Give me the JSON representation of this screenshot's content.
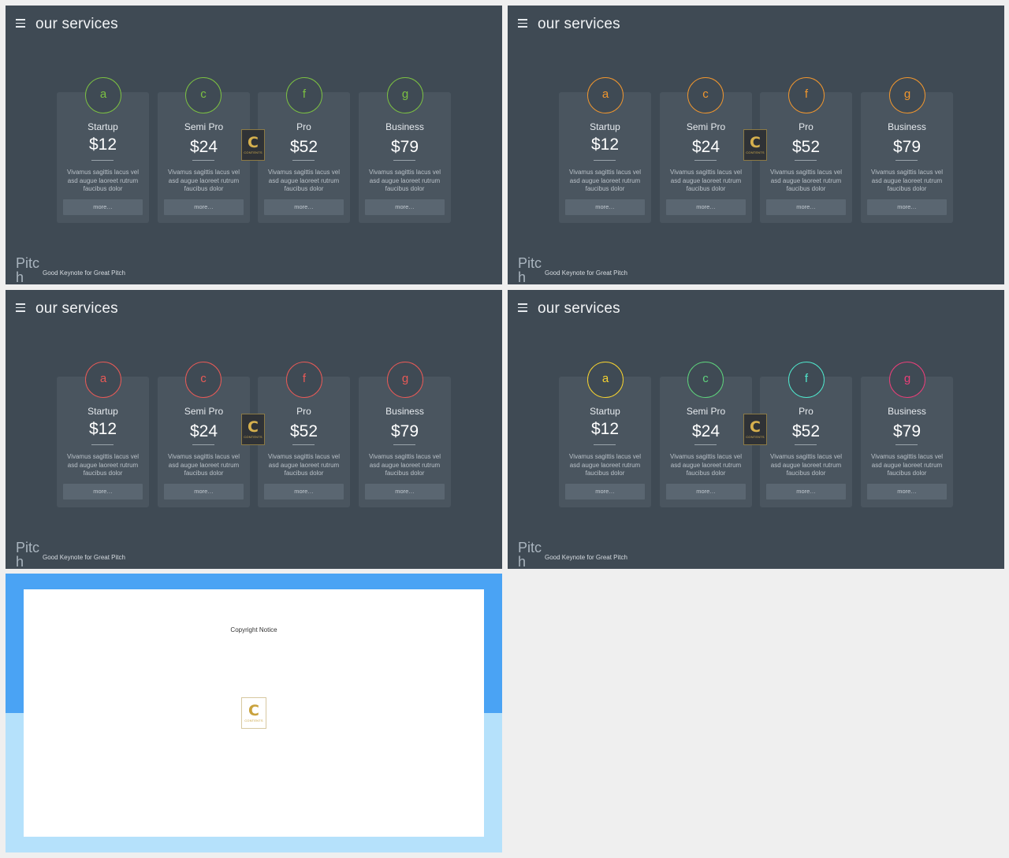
{
  "slide_title": "our services",
  "brand": "Pitch",
  "tagline": "Good Keynote for Great Pitch",
  "cards": [
    {
      "plan": "Startup",
      "price": "$12",
      "desc": "Vivamus sagittis lacus vel asd augue laoreet rutrum faucibus dolor",
      "more": "more…"
    },
    {
      "plan": "Semi Pro",
      "price": "$24",
      "desc": "Vivamus sagittis lacus vel asd augue laoreet rutrum faucibus dolor",
      "more": "more…"
    },
    {
      "plan": "Pro",
      "price": "$52",
      "desc": "Vivamus sagittis lacus vel asd augue laoreet rutrum faucibus dolor",
      "more": "more…"
    },
    {
      "plan": "Business",
      "price": "$79",
      "desc": "Vivamus sagittis lacus vel asd augue laoreet rutrum faucibus dolor",
      "more": "more…"
    }
  ],
  "icon_glyphs": [
    "a",
    "c",
    "f",
    "g"
  ],
  "slides": [
    {
      "icon_colors": [
        "#7cc142",
        "#7cc142",
        "#7cc142",
        "#7cc142"
      ]
    },
    {
      "icon_colors": [
        "#f0962e",
        "#f0962e",
        "#f0962e",
        "#f0962e"
      ]
    },
    {
      "icon_colors": [
        "#e85a57",
        "#e85a57",
        "#e85a57",
        "#e85a57"
      ]
    },
    {
      "icon_colors": [
        "#f5d230",
        "#5ed27c",
        "#4fe6cc",
        "#ea3f79"
      ]
    }
  ],
  "badge": {
    "letter": "C",
    "text": "CONTENTS"
  },
  "copyright_title": "Copyright Notice"
}
